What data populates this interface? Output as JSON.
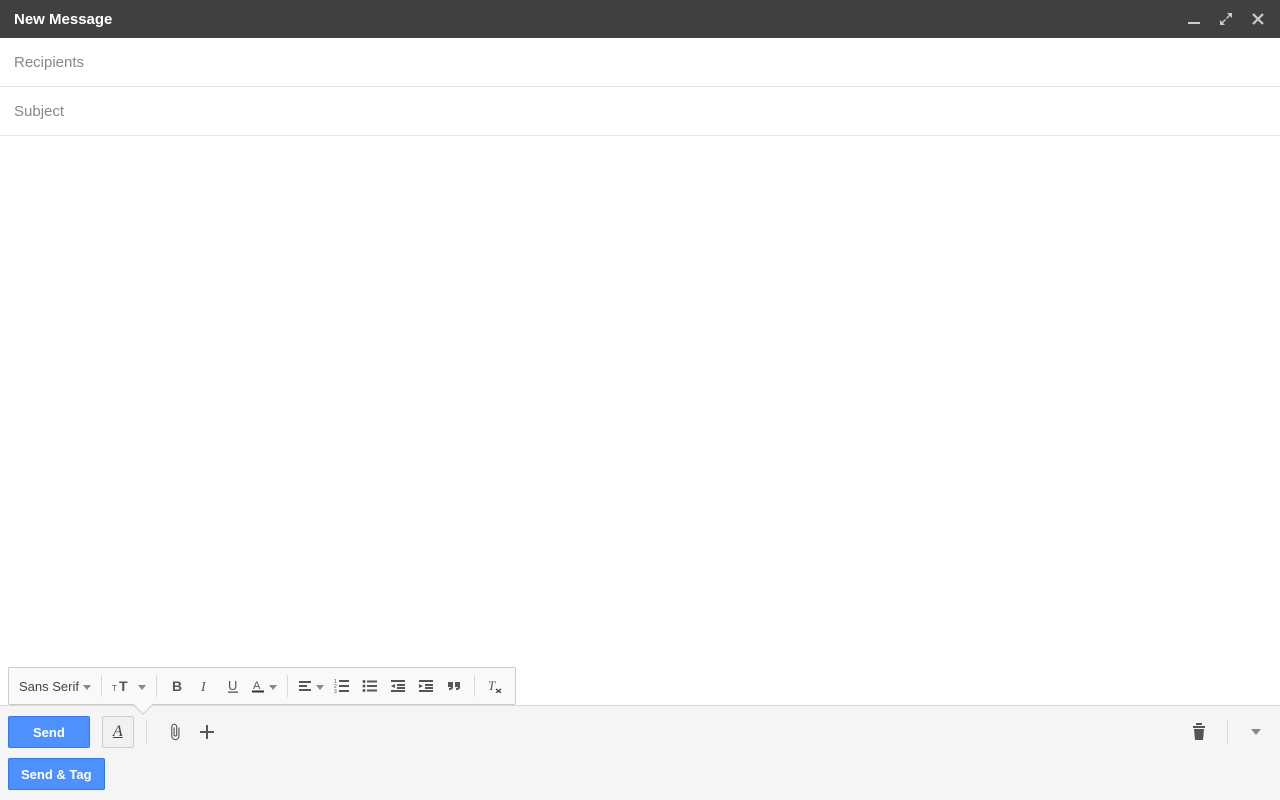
{
  "titlebar": {
    "title": "New Message"
  },
  "fields": {
    "recipients_placeholder": "Recipients",
    "subject_placeholder": "Subject",
    "recipients_value": "",
    "subject_value": "",
    "body_value": ""
  },
  "format_toolbar": {
    "font_name": "Sans Serif"
  },
  "sendbar": {
    "send_label": "Send",
    "send_tag_label": "Send & Tag"
  },
  "icons": {
    "minimize": "minimize-icon",
    "popout": "popout-icon",
    "close": "close-icon",
    "font_size": "font-size-icon",
    "bold": "bold-icon",
    "italic": "italic-icon",
    "underline": "underline-icon",
    "text_color": "text-color-icon",
    "align": "align-icon",
    "ordered_list": "ordered-list-icon",
    "bullet_list": "bullet-list-icon",
    "indent_less": "indent-less-icon",
    "indent_more": "indent-more-icon",
    "quote": "quote-icon",
    "clear_format": "clear-format-icon",
    "attach": "attach-icon",
    "insert": "insert-icon",
    "trash": "trash-icon",
    "more": "more-icon"
  }
}
